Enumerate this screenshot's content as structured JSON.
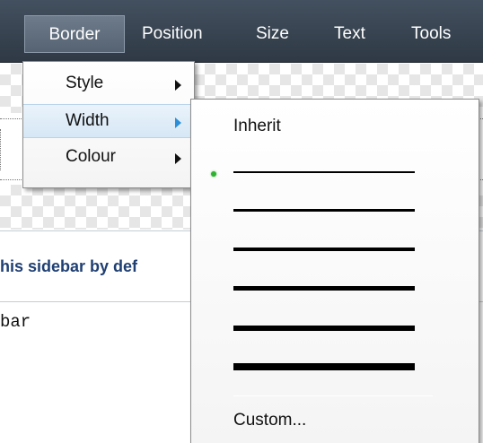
{
  "menubar": {
    "items": [
      {
        "label": "Border",
        "active": true
      },
      {
        "label": "Position",
        "active": false
      },
      {
        "label": "Size",
        "active": false
      },
      {
        "label": "Text",
        "active": false
      },
      {
        "label": "Tools",
        "active": false
      }
    ]
  },
  "border_menu": {
    "items": [
      {
        "label": "Style",
        "has_submenu": true
      },
      {
        "label": "Width",
        "has_submenu": true,
        "highlighted": true
      },
      {
        "label": "Colour",
        "has_submenu": true
      }
    ]
  },
  "width_submenu": {
    "inherit_label": "Inherit",
    "widths": [
      {
        "name": "width-1",
        "selected": true
      },
      {
        "name": "width-2",
        "selected": false
      },
      {
        "name": "width-3",
        "selected": false
      },
      {
        "name": "width-4",
        "selected": false
      },
      {
        "name": "width-5",
        "selected": false
      },
      {
        "name": "width-6",
        "selected": false
      }
    ],
    "custom_label": "Custom..."
  },
  "document": {
    "sidebar_heading": "his sidebar by def",
    "sidebar_code": "bar"
  },
  "colors": {
    "menubar_bg": "#37424f",
    "menubar_active": "#607080",
    "heading_text": "#1f3f73",
    "selected_indicator": "#2fb233",
    "hover_arrow": "#2a8fd8"
  }
}
